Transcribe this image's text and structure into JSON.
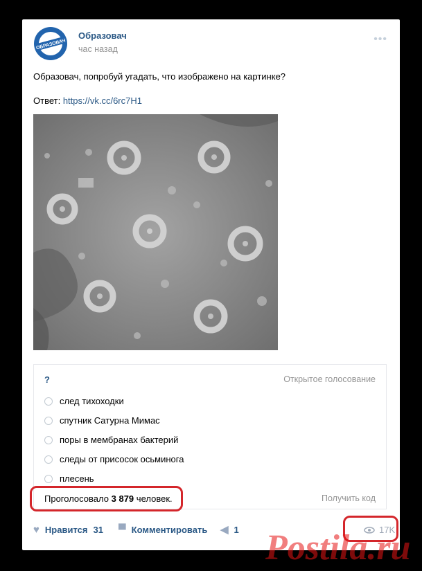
{
  "post": {
    "author": "Образовач",
    "time": "час назад",
    "text": "Образовач, попробуй угадать, что изображено на картинке?",
    "answer_label": "Ответ:",
    "answer_link": "https://vk.cc/6rc7H1"
  },
  "poll": {
    "question": "?",
    "type": "Открытое голосование",
    "options": [
      "след тихоходки",
      "спутник Сатурна Мимас",
      "поры в мембранах бактерий",
      "следы от присосок осьминога",
      "плесень"
    ],
    "votes_prefix": "Проголосовало",
    "votes_count": "3 879",
    "votes_suffix": "человек.",
    "get_code": "Получить код"
  },
  "footer": {
    "like_label": "Нравится",
    "like_count": "31",
    "comment_label": "Комментировать",
    "share_count": "1",
    "views": "17K"
  },
  "watermark": "Postila.ru",
  "logo_text": "ОБРАЗОВАЧ",
  "colors": {
    "link": "#2a5885",
    "muted": "#939393",
    "highlight": "#d4262b"
  }
}
